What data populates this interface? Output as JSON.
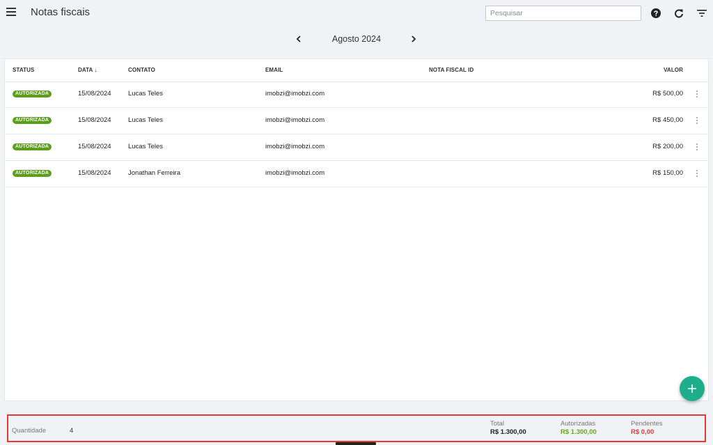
{
  "header": {
    "title": "Notas fiscais",
    "search_placeholder": "Pesquisar"
  },
  "month_nav": {
    "label": "Agosto 2024"
  },
  "table": {
    "columns": {
      "status": "STATUS",
      "data": "DATA ↓",
      "contato": "CONTATO",
      "email": "EMAIL",
      "nota_id": "NOTA FISCAL ID",
      "valor": "VALOR"
    },
    "rows": [
      {
        "status": "AUTORIZADA",
        "data": "15/08/2024",
        "contato": "Lucas Teles",
        "email": "imobzi@imobzi.com",
        "nota_id": "",
        "valor": "R$ 500,00"
      },
      {
        "status": "AUTORIZADA",
        "data": "15/08/2024",
        "contato": "Lucas Teles",
        "email": "imobzi@imobzi.com",
        "nota_id": "",
        "valor": "R$ 450,00"
      },
      {
        "status": "AUTORIZADA",
        "data": "15/08/2024",
        "contato": "Lucas Teles",
        "email": "imobzi@imobzi.com",
        "nota_id": "",
        "valor": "R$ 200,00"
      },
      {
        "status": "AUTORIZADA",
        "data": "15/08/2024",
        "contato": "Jonathan Ferreira",
        "email": "imobzi@imobzi.com",
        "nota_id": "",
        "valor": "R$ 150,00"
      }
    ]
  },
  "footer": {
    "quantidade_label": "Quantidade",
    "quantidade_value": "4",
    "total_label": "Total",
    "total_value": "R$ 1.300,00",
    "autorizadas_label": "Autorizadas",
    "autorizadas_value": "R$ 1.300,00",
    "pendentes_label": "Pendentes",
    "pendentes_value": "R$ 0,00"
  },
  "colors": {
    "status_authorized": "#5a9e1c",
    "fab": "#1fae8c",
    "pendentes": "#e53935",
    "autorizadas": "#6aa621",
    "highlight_border": "#e53935"
  },
  "icons": [
    "menu-icon",
    "help-icon",
    "refresh-icon",
    "filter-icon",
    "chevron-left-icon",
    "chevron-right-icon",
    "more-vertical-icon",
    "plus-icon"
  ]
}
